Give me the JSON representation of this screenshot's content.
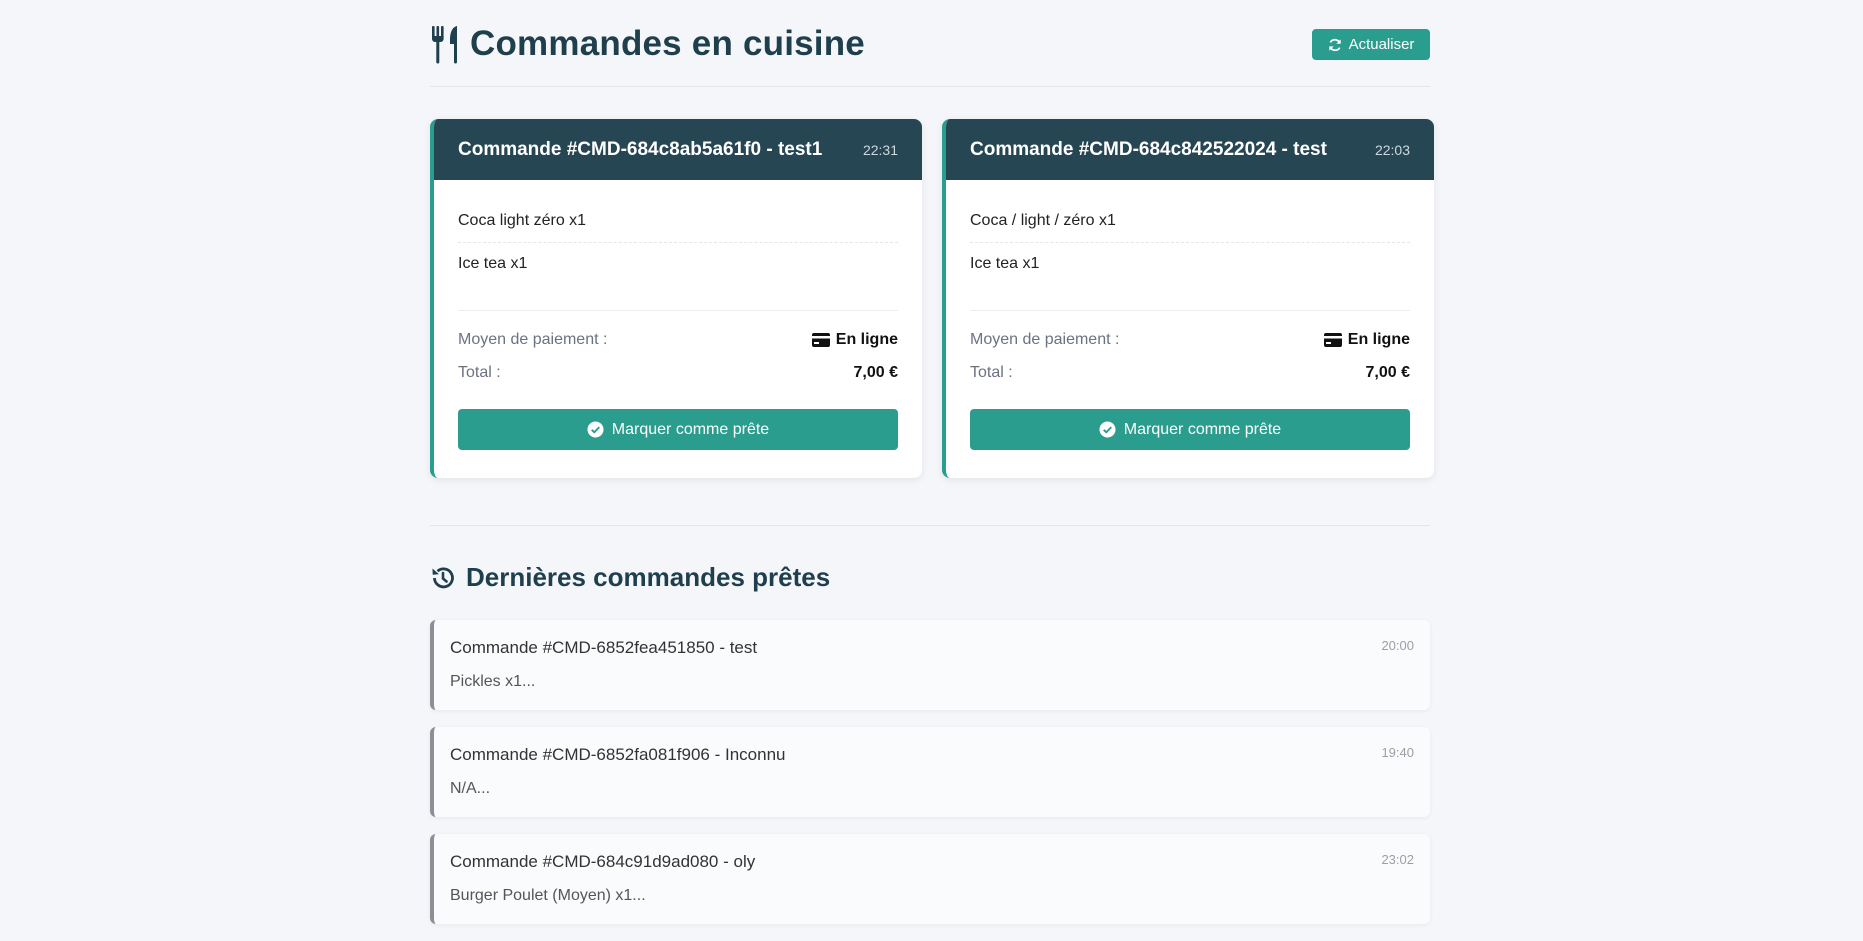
{
  "header": {
    "title": "Commandes en cuisine",
    "refresh_label": "Actualiser"
  },
  "orders": [
    {
      "title": "Commande #CMD-684c8ab5a61f0 - test1",
      "time": "22:31",
      "items": [
        "Coca light zéro x1",
        "Ice tea x1"
      ],
      "payment_label": "Moyen de paiement :",
      "payment_value": "En ligne",
      "total_label": "Total :",
      "total_value": "7,00 €",
      "action_label": "Marquer comme prête"
    },
    {
      "title": "Commande #CMD-684c842522024 - test",
      "time": "22:03",
      "items": [
        "Coca / light / zéro x1",
        "Ice tea x1"
      ],
      "payment_label": "Moyen de paiement :",
      "payment_value": "En ligne",
      "total_label": "Total :",
      "total_value": "7,00 €",
      "action_label": "Marquer comme prête"
    }
  ],
  "recent": {
    "title": "Dernières commandes prêtes",
    "items": [
      {
        "name": "Commande #CMD-6852fea451850 - test",
        "desc": "Pickles x1...",
        "time": "20:00"
      },
      {
        "name": "Commande #CMD-6852fa081f906 - Inconnu",
        "desc": "N/A...",
        "time": "19:40"
      },
      {
        "name": "Commande #CMD-684c91d9ad080 - oly",
        "desc": "Burger Poulet (Moyen) x1...",
        "time": "23:02"
      }
    ]
  },
  "colors": {
    "accent": "#2a9d8f",
    "header_dark": "#264653",
    "background": "#f4f6fa"
  },
  "icons": {
    "title": "utensils-icon",
    "refresh": "sync-icon",
    "payment": "credit-card-icon",
    "ready": "check-circle-icon",
    "recent": "history-icon"
  }
}
